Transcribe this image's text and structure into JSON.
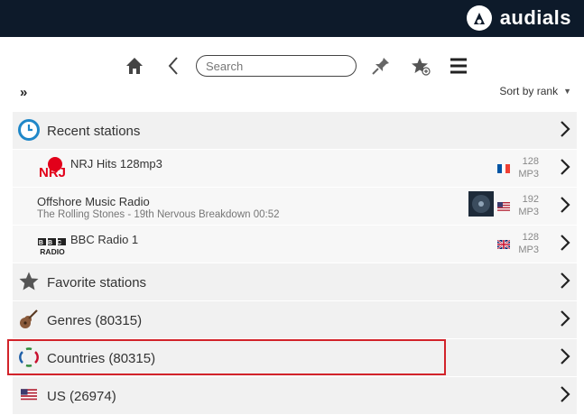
{
  "app": {
    "brand": "audials",
    "accent": "#0d1a2a",
    "highlight_color": "#d2232a"
  },
  "toolbar": {
    "home_icon": "home-icon",
    "back_icon": "back-chevron-icon",
    "search": {
      "placeholder": "Search",
      "value": ""
    },
    "pin_icon": "pin-icon",
    "favorite_add_icon": "star-add-icon",
    "menu_icon": "hamburger-menu-icon"
  },
  "subbar": {
    "expand_label": "»",
    "sort_label": "Sort by rank"
  },
  "recent": {
    "label": "Recent stations",
    "stations": [
      {
        "name": "NRJ Hits 128mp3",
        "subtitle": "",
        "logo_text": "NRJ",
        "bitrate": "128",
        "format": "MP3",
        "flag": "FR"
      },
      {
        "name": "Offshore Music Radio",
        "subtitle": "The Rolling Stones - 19th Nervous Breakdown 00:52",
        "bitrate": "192",
        "format": "MP3",
        "flag": "US"
      },
      {
        "name": "BBC Radio 1",
        "subtitle": "",
        "logo_text_top": "BBC",
        "logo_text_bottom": "RADIO",
        "bitrate": "128",
        "format": "MP3",
        "flag": "GB"
      }
    ]
  },
  "categories": [
    {
      "label": "Favorite stations",
      "icon": "star-icon"
    },
    {
      "label": "Genres (80315)",
      "icon": "guitar-icon"
    },
    {
      "label": "Countries (80315)",
      "icon": "globe-flags-icon"
    },
    {
      "label": "US (26974)",
      "icon": "us-flag-icon"
    }
  ]
}
